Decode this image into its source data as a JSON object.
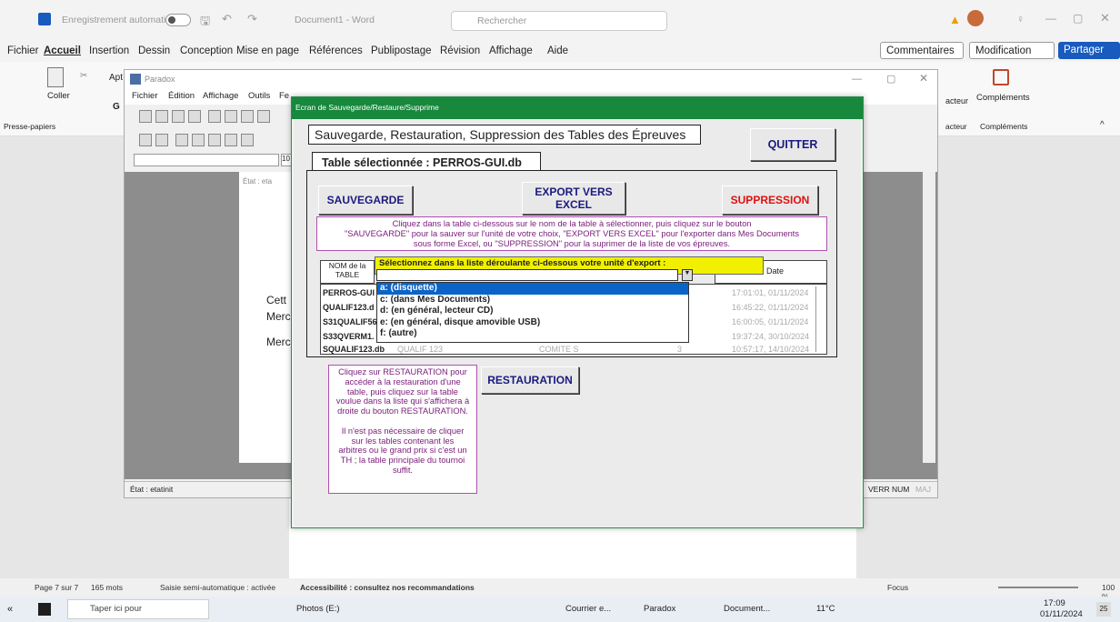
{
  "word": {
    "autosave_label": "Enregistrement automatique",
    "doc_title": "Document1 - Word",
    "search_placeholder": "Rechercher",
    "menu": [
      "Fichier",
      "Accueil",
      "Insertion",
      "Dessin",
      "Conception",
      "Mise en page",
      "Références",
      "Publipostage",
      "Révision",
      "Affichage",
      "Aide"
    ],
    "comments_btn": "Commentaires",
    "modification_btn": "Modification",
    "share_btn": "Partager",
    "ribbon": {
      "paste": "Coller",
      "clipboard": "Presse-papiers",
      "font_box": "Apt",
      "bold": "G",
      "addins": "Compléments",
      "addins_group": "Compléments",
      "dictate_group": "acteur"
    },
    "status": {
      "page": "Page 7 sur 7",
      "words": "165 mots",
      "input": "Saisie semi-automatique : activée",
      "access": "Accessibilité : consultez nos recommandations",
      "focus": "Focus",
      "zoom": "100 %"
    },
    "page_text": [
      "Cett",
      "Merc",
      "Merc"
    ]
  },
  "paradox": {
    "title": "Paradox",
    "menu": [
      "Fichier",
      "Édition",
      "Affichage",
      "Outils",
      "Fe"
    ],
    "status": "État : etatinit",
    "numlock": "VERR NUM",
    "maj": "MAJ",
    "state_tab": "État : eta",
    "toolbar_field": "10"
  },
  "dialog": {
    "title": "Ecran de Sauvegarde/Restaure/Supprime",
    "heading": "Sauvegarde, Restauration, Suppression des Tables des Épreuves",
    "quit": "QUITTER",
    "table_selected": "Table sélectionnée :  PERROS-GUI.db",
    "btn_save": "SAUVEGARDE",
    "btn_export_1": "EXPORT VERS",
    "btn_export_2": "EXCEL",
    "btn_delete": "SUPPRESSION",
    "instructions_1": "Cliquez dans la table ci-dessous sur le nom de la table à sélectionner, puis cliquez sur le bouton",
    "instructions_2": "\"SAUVEGARDE\" pour la sauver sur l'unité de votre choix, \"EXPORT VERS EXCEL\" pour l'exporter dans Mes Documents",
    "instructions_3": "sous forme Excel, ou \"SUPPRESSION\" pour la suprimer de la liste de vos épreuves.",
    "col_name_1": "NOM de la",
    "col_name_2": "TABLE",
    "col_date": "Date",
    "export_prompt": "Sélectionnez dans la liste déroulante ci-dessous votre unité d'export :",
    "export_options": [
      "a: (disquette)",
      "c: (dans Mes Documents)",
      "d: (en général, lecteur CD)",
      "e: (en général, disque amovible USB)",
      "f: (autre)"
    ],
    "rows": [
      {
        "name": "PERROS-GUI",
        "date": "17:01:01, 01/11/2024"
      },
      {
        "name": "QUALIF123.d",
        "date": "16:45:22, 01/11/2024"
      },
      {
        "name": "S31QUALIF56",
        "date": "16:00:05, 01/11/2024"
      },
      {
        "name": "S33QVERM1.",
        "date": "19:37:24, 30/10/2024"
      },
      {
        "name": "SQUALIF123.db",
        "extra1": "QUALIF 123",
        "extra2": "COMITE S",
        "num": "3",
        "date": "10:57:17, 14/10/2024"
      }
    ],
    "restore_help": [
      "Cliquez sur RESTAURATION pour",
      "accéder à la restauration d'une",
      "table, puis cliquez sur la table",
      "voulue dans la liste qui s'affichera à",
      "droite du bouton RESTAURATION.",
      "",
      "Il n'est pas nécessaire de cliquer",
      "sur les tables contenant les",
      "arbitres ou le grand prix si c'est un",
      "TH ; la table principale du tournoi",
      "suffit."
    ],
    "btn_restore": "RESTAURATION"
  },
  "taskbar": {
    "search": "Taper ici pour",
    "photos": "Photos (E:)",
    "mail": "Courrier e...",
    "paradox": "Paradox",
    "word": "Document...",
    "temp": "11°C",
    "time": "17:09",
    "date": "01/11/2024",
    "notif": "25"
  }
}
